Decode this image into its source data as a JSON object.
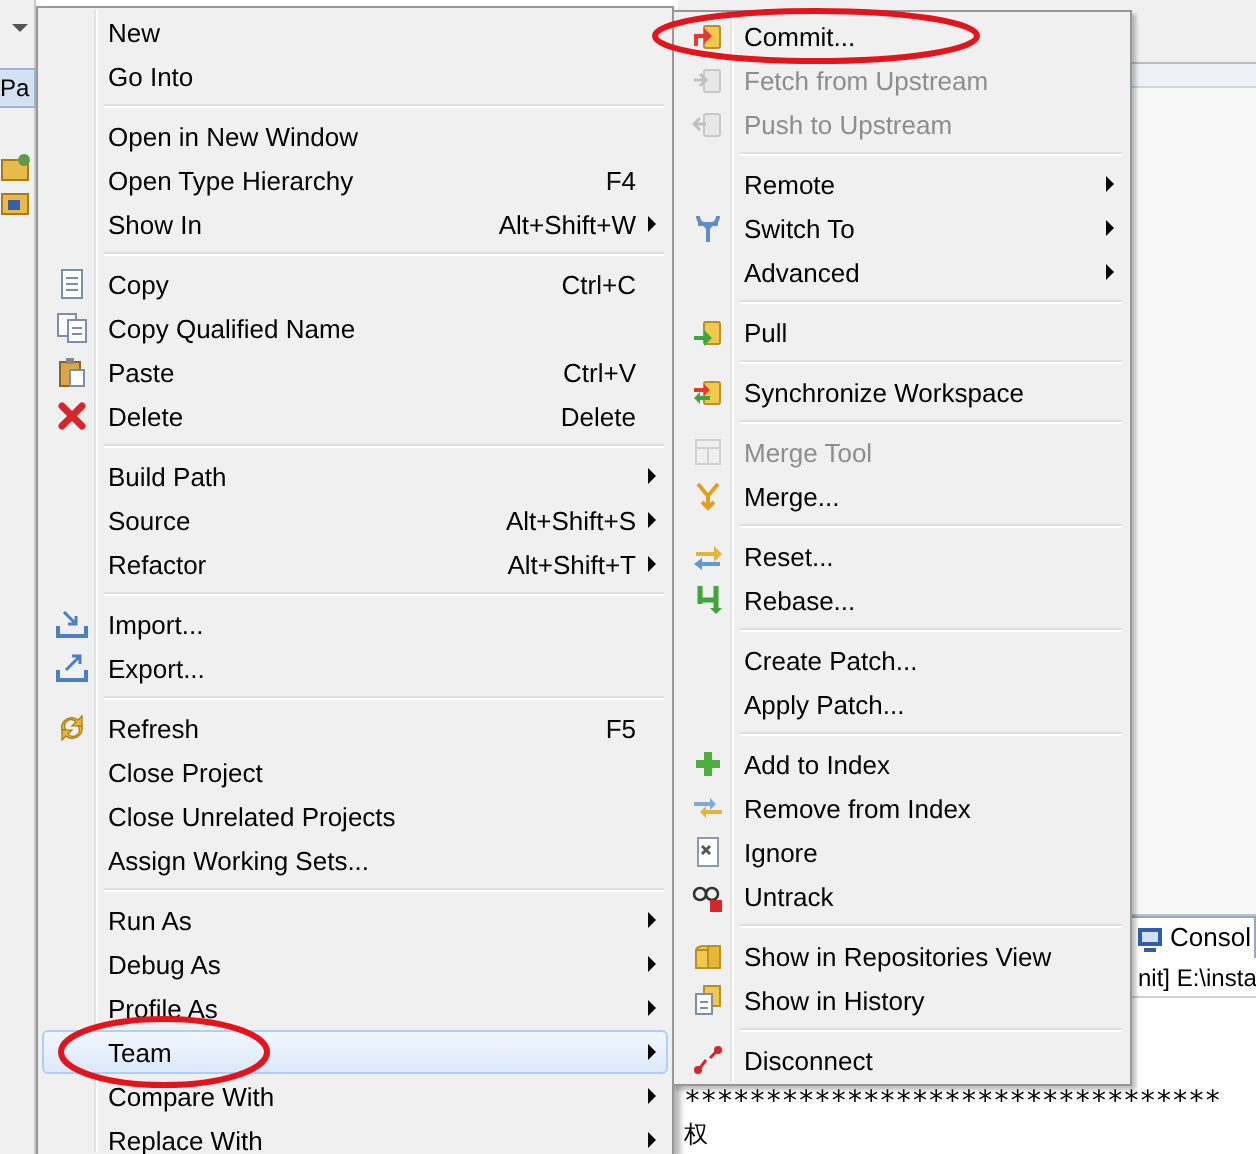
{
  "background": {
    "package_tab": "Pa",
    "console_tab": "Consol",
    "console_header": "nit] E:\\insta",
    "console_lines": [
      "*********************************",
      "权"
    ]
  },
  "context_menu": {
    "groups": [
      {
        "items": [
          {
            "label": "New",
            "selected": false,
            "circled": false
          },
          {
            "label": "Go Into",
            "selected": false,
            "circled": false
          }
        ]
      },
      {
        "items": [
          {
            "label": "Open in New Window",
            "selected": false,
            "circled": false
          },
          {
            "label": "Open Type Hierarchy",
            "shortcut": "F4",
            "selected": false,
            "circled": false
          },
          {
            "label": "Show In",
            "shortcut": "Alt+Shift+W",
            "submenu": true,
            "selected": false,
            "circled": false
          }
        ]
      },
      {
        "items": [
          {
            "label": "Copy",
            "shortcut": "Ctrl+C",
            "selected": false,
            "circled": false
          },
          {
            "label": "Copy Qualified Name",
            "selected": false,
            "circled": false
          },
          {
            "label": "Paste",
            "shortcut": "Ctrl+V",
            "selected": false,
            "circled": false
          },
          {
            "label": "Delete",
            "shortcut": "Delete",
            "selected": false,
            "circled": false
          }
        ]
      },
      {
        "items": [
          {
            "label": "Build Path",
            "submenu": true,
            "selected": false,
            "circled": false
          },
          {
            "label": "Source",
            "shortcut": "Alt+Shift+S",
            "submenu": true,
            "selected": false,
            "circled": false
          },
          {
            "label": "Refactor",
            "shortcut": "Alt+Shift+T",
            "submenu": true,
            "selected": false,
            "circled": false
          }
        ]
      },
      {
        "items": [
          {
            "label": "Import...",
            "selected": false,
            "circled": false
          },
          {
            "label": "Export...",
            "selected": false,
            "circled": false
          }
        ]
      },
      {
        "items": [
          {
            "label": "Refresh",
            "shortcut": "F5",
            "selected": false,
            "circled": false
          },
          {
            "label": "Close Project",
            "selected": false,
            "circled": false
          },
          {
            "label": "Close Unrelated Projects",
            "selected": false,
            "circled": false
          },
          {
            "label": "Assign Working Sets...",
            "selected": false,
            "circled": false
          }
        ]
      },
      {
        "items": [
          {
            "label": "Run As",
            "submenu": true,
            "selected": false,
            "circled": false
          },
          {
            "label": "Debug As",
            "submenu": true,
            "selected": false,
            "circled": false
          },
          {
            "label": "Profile As",
            "submenu": true,
            "selected": false,
            "circled": false
          },
          {
            "label": "Team",
            "submenu": true,
            "selected": true,
            "circled": true
          },
          {
            "label": "Compare With",
            "submenu": true,
            "selected": false,
            "circled": false
          },
          {
            "label": "Replace With",
            "submenu": true,
            "selected": false,
            "circled": false
          }
        ]
      }
    ]
  },
  "team_submenu": {
    "groups": [
      {
        "items": [
          {
            "label": "Commit...",
            "disabled": false,
            "circled": true
          },
          {
            "label": "Fetch from Upstream",
            "disabled": true,
            "circled": false
          },
          {
            "label": "Push to Upstream",
            "disabled": true,
            "circled": false
          }
        ]
      },
      {
        "items": [
          {
            "label": "Remote",
            "submenu": true,
            "disabled": false,
            "circled": false
          },
          {
            "label": "Switch To",
            "submenu": true,
            "disabled": false,
            "circled": false
          },
          {
            "label": "Advanced",
            "submenu": true,
            "disabled": false,
            "circled": false
          }
        ]
      },
      {
        "items": [
          {
            "label": "Pull",
            "disabled": false,
            "circled": false
          }
        ]
      },
      {
        "items": [
          {
            "label": "Synchronize Workspace",
            "disabled": false,
            "circled": false
          }
        ]
      },
      {
        "items": [
          {
            "label": "Merge Tool",
            "disabled": true,
            "circled": false
          },
          {
            "label": "Merge...",
            "disabled": false,
            "circled": false
          }
        ]
      },
      {
        "items": [
          {
            "label": "Reset...",
            "disabled": false,
            "circled": false
          },
          {
            "label": "Rebase...",
            "disabled": false,
            "circled": false
          }
        ]
      },
      {
        "items": [
          {
            "label": "Create Patch...",
            "disabled": false,
            "circled": false
          },
          {
            "label": "Apply Patch...",
            "disabled": false,
            "circled": false
          }
        ]
      },
      {
        "items": [
          {
            "label": "Add to Index",
            "disabled": false,
            "circled": false
          },
          {
            "label": "Remove from Index",
            "disabled": false,
            "circled": false
          },
          {
            "label": "Ignore",
            "disabled": false,
            "circled": false
          },
          {
            "label": "Untrack",
            "disabled": false,
            "circled": false
          }
        ]
      },
      {
        "items": [
          {
            "label": "Show in Repositories View",
            "disabled": false,
            "circled": false
          },
          {
            "label": "Show in History",
            "disabled": false,
            "circled": false
          }
        ]
      },
      {
        "items": [
          {
            "label": "Disconnect",
            "disabled": false,
            "circled": false
          }
        ]
      }
    ]
  }
}
